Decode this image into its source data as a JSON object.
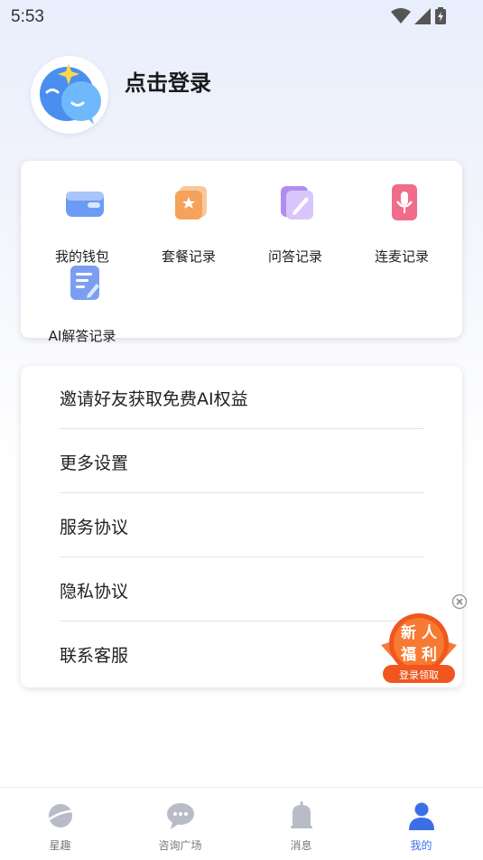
{
  "status_bar": {
    "time": "5:53"
  },
  "profile": {
    "login_text": "点击登录"
  },
  "shortcuts": [
    {
      "label": "我的钱包",
      "icon": "wallet-icon"
    },
    {
      "label": "套餐记录",
      "icon": "package-icon"
    },
    {
      "label": "问答记录",
      "icon": "qa-record-icon"
    },
    {
      "label": "连麦记录",
      "icon": "mic-record-icon"
    },
    {
      "label": "AI解答记录",
      "icon": "ai-answer-icon"
    }
  ],
  "menu": [
    {
      "label": "邀请好友获取免费AI权益"
    },
    {
      "label": "更多设置"
    },
    {
      "label": "服务协议"
    },
    {
      "label": "隐私协议"
    },
    {
      "label": "联系客服"
    }
  ],
  "promo": {
    "line1": "新 人",
    "line2": "福 利",
    "button": "登录领取"
  },
  "tabs": [
    {
      "label": "星趣",
      "icon": "planet-icon"
    },
    {
      "label": "咨询广场",
      "icon": "chat-bubble-icon"
    },
    {
      "label": "消息",
      "icon": "bell-icon"
    },
    {
      "label": "我的",
      "icon": "user-icon"
    }
  ],
  "colors": {
    "accent": "#3a6fe8",
    "promo": "#f2581e"
  }
}
